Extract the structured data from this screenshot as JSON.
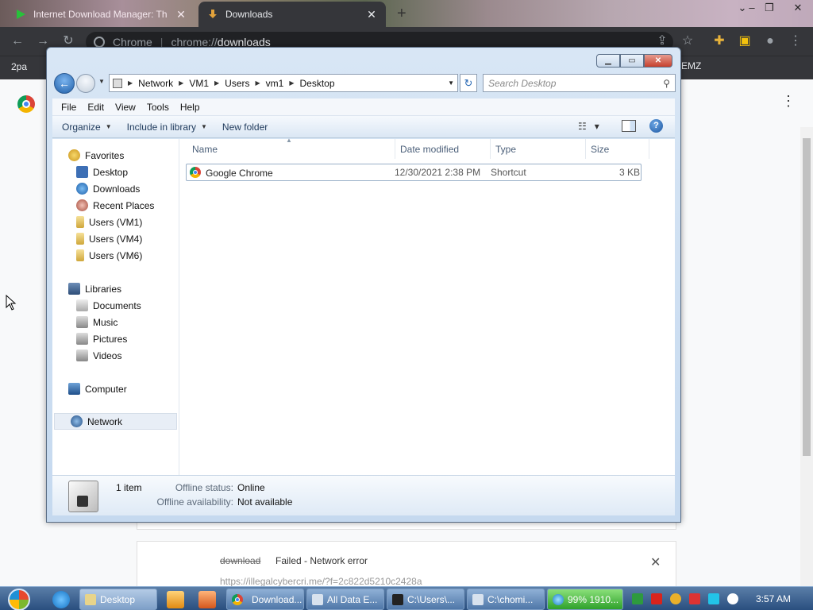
{
  "chrome": {
    "tabs": [
      {
        "title": "Internet Download Manager: Th",
        "active": false
      },
      {
        "title": "Downloads",
        "active": true
      }
    ],
    "new_tab": "+",
    "omnibox_site": "Chrome",
    "omnibox_url_prefix": "chrome://",
    "omnibox_url_path": "downloads",
    "bookmark_left": "2pa",
    "bookmark_right": "EMZ",
    "download_item": {
      "name": "download",
      "status": "Failed - Network error",
      "url": "https://illegalcybercri.me/?f=2c822d5210c2428a"
    }
  },
  "explorer": {
    "breadcrumbs": [
      "Network",
      "VM1",
      "Users",
      "vm1",
      "Desktop"
    ],
    "search_placeholder": "Search Desktop",
    "menu": [
      "File",
      "Edit",
      "View",
      "Tools",
      "Help"
    ],
    "commands": {
      "organize": "Organize",
      "include": "Include in library",
      "new_folder": "New folder"
    },
    "nav": {
      "favorites_label": "Favorites",
      "favorites": [
        "Desktop",
        "Downloads",
        "Recent Places",
        "Users (VM1)",
        "Users (VM4)",
        "Users (VM6)"
      ],
      "libraries_label": "Libraries",
      "libraries": [
        "Documents",
        "Music",
        "Pictures",
        "Videos"
      ],
      "computer_label": "Computer",
      "network_label": "Network"
    },
    "columns": [
      "Name",
      "Date modified",
      "Type",
      "Size"
    ],
    "files": [
      {
        "name": "Google Chrome",
        "date": "12/30/2021 2:38 PM",
        "type": "Shortcut",
        "size": "3 KB"
      }
    ],
    "details": {
      "count": "1 item",
      "offline_status_label": "Offline status:",
      "offline_status_value": "Online",
      "offline_avail_label": "Offline availability:",
      "offline_avail_value": "Not available"
    }
  },
  "taskbar": {
    "tasks": [
      "Desktop",
      "Download...",
      "All Data E...",
      "C:\\Users\\...",
      "C:\\chomi...",
      "99% 1910..."
    ],
    "clock": "3:57 AM"
  },
  "colors": {
    "chrome_dark": "#35363a",
    "explorer_frame": "#c5d9ef",
    "taskbar": "#2a4f7f"
  }
}
